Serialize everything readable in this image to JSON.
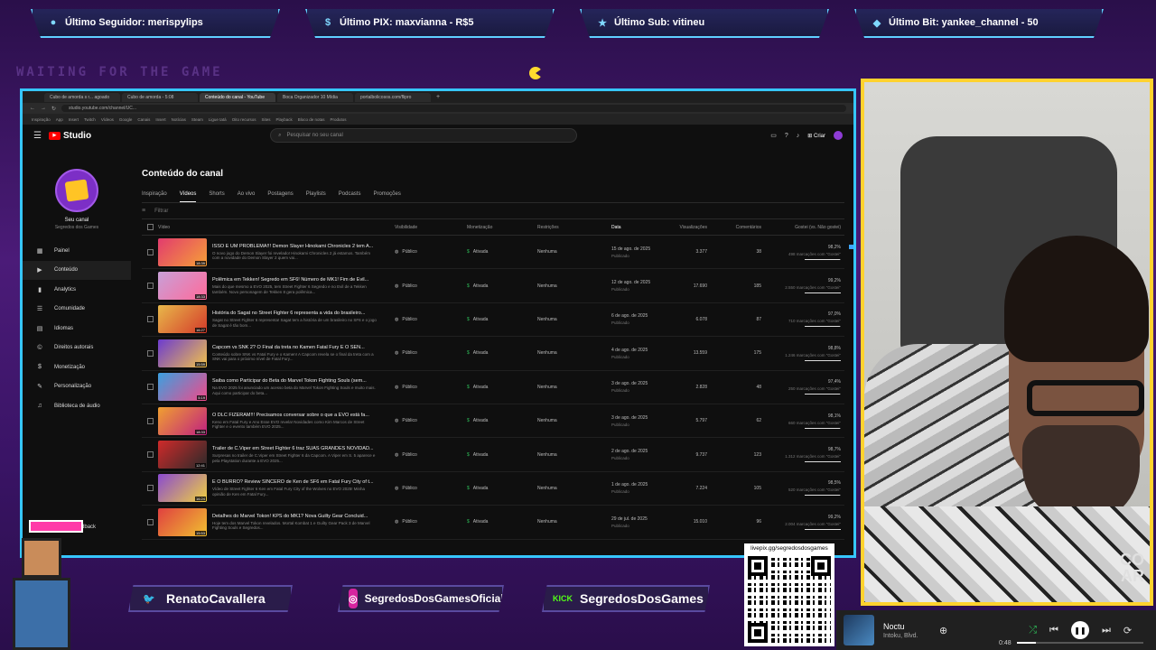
{
  "alerts": [
    {
      "label": "Último Seguidor: merispylips",
      "icon": "user-icon"
    },
    {
      "label": "Último PIX: maxvianna - R$5",
      "icon": "dollar-icon"
    },
    {
      "label": "Último Sub: vitineu",
      "icon": "star-icon"
    },
    {
      "label": "Último Bit: yankee_channel - 50",
      "icon": "diamond-icon"
    }
  ],
  "background_text": "WAITING FOR THE GAME",
  "browser": {
    "tabs": [
      "Cubo de amorda s r... agoado",
      "Cubo de amorda - 5:08",
      "Conteúdo do canal - YouTube",
      "Boca Organizador 10 Mídia",
      "portalbolicosos.com/flipro"
    ],
    "url": "studio.youtube.com/channel/UC...",
    "bookmarks": [
      "Inspiração",
      "App",
      "Insert",
      "Twitch",
      "Vídeos",
      "Google",
      "Canais",
      "Insert",
      "Notícias",
      "Steam",
      "Ligue tatá",
      "Oito recursos",
      "Sites",
      "Playback",
      "Bloco de notas",
      "Produtos"
    ]
  },
  "studio": {
    "logo_text": "Studio",
    "search_placeholder": "Pesquisar no seu canal",
    "create_label": "Criar",
    "channel_name": "Seu canal",
    "channel_handle": "Segredos dos Games",
    "nav": [
      {
        "label": "Painel",
        "icon": "dashboard-icon",
        "glyph": "▦"
      },
      {
        "label": "Conteúdo",
        "icon": "content-icon",
        "glyph": "▶",
        "active": true
      },
      {
        "label": "Analytics",
        "icon": "analytics-icon",
        "glyph": "▮"
      },
      {
        "label": "Comunidade",
        "icon": "community-icon",
        "glyph": "☰"
      },
      {
        "label": "Idiomas",
        "icon": "languages-icon",
        "glyph": "▤"
      },
      {
        "label": "Direitos autorais",
        "icon": "copyright-icon",
        "glyph": "©"
      },
      {
        "label": "Monetização",
        "icon": "monetization-icon",
        "glyph": "$"
      },
      {
        "label": "Personalização",
        "icon": "customization-icon",
        "glyph": "✎"
      },
      {
        "label": "Biblioteca de áudio",
        "icon": "audio-library-icon",
        "glyph": "♫"
      }
    ],
    "feedback_label": "Enviar feedback",
    "page_title": "Conteúdo do canal",
    "tabs": [
      "Inspiração",
      "Vídeos",
      "Shorts",
      "Ao vivo",
      "Postagens",
      "Playlists",
      "Podcasts",
      "Promoções"
    ],
    "active_tab": "Vídeos",
    "filter_label": "Filtrar",
    "columns": [
      "Vídeo",
      "Visibilidade",
      "Monetização",
      "Restrições",
      "Data",
      "Visualizações",
      "Comentários",
      "Gostei (vs. Não gostei)"
    ],
    "videos": [
      {
        "title": "ISSO É UM PROBLEMA!!! Demon Slayer Hinokami Chronicles 2 tem A...",
        "desc": "O novo jogo do Demon Slayer foi revelado! Hinokami Chronicles 2 já estamos. Também com a novidade do Demon Slayer 2 quem vai...",
        "duration": "18:39",
        "visibility": "Público",
        "monetization": "Ativada",
        "restrictions": "Nenhuma",
        "date": "15 de ago. de 2025",
        "status": "Publicado",
        "views": "3.377",
        "comments": "38",
        "likes_pct": "98,2%",
        "likes_sub": "498 marcações com \"Gostei\"",
        "ratio": 0.98,
        "thumb": [
          "#e23b6e",
          "#f6a037"
        ]
      },
      {
        "title": "Polêmica em Tekken! Segredo em SF6! Número de MK1! Fim de Evil...",
        "desc": "Mais do que mesmo a EVO 2025, tem Street Fighter 6 Segredo e no Evil de a Tekken também. Novo personagem de Tekken 8 gera polêmica...",
        "duration": "18:33",
        "visibility": "Público",
        "monetization": "Ativada",
        "restrictions": "Nenhuma",
        "date": "12 de ago. de 2025",
        "status": "Publicado",
        "views": "17.690",
        "comments": "185",
        "likes_pct": "99,2%",
        "likes_sub": "2.550 marcações com \"Gostei\"",
        "ratio": 0.99,
        "thumb": [
          "#c8a0d8",
          "#ff6a9a"
        ]
      },
      {
        "title": "História do Sagat no Street Fighter 6 representa a vida do brasileiro...",
        "desc": "Sagat no Street Fighter 6 representa! Sagat tem a história de um brasileiro no SF6 e o jogo de Sagat é tão bom...",
        "duration": "16:27",
        "visibility": "Público",
        "monetization": "Ativada",
        "restrictions": "Nenhuma",
        "date": "6 de ago. de 2025",
        "status": "Publicado",
        "views": "6.078",
        "comments": "87",
        "likes_pct": "97,0%",
        "likes_sub": "710 marcações com \"Gostei\"",
        "ratio": 0.97,
        "thumb": [
          "#e8b84a",
          "#d43a2a"
        ]
      },
      {
        "title": "Capcom vs SNK 2? O Final da treta no Kamen Fatal Fury É O SEN...",
        "desc": "Conteúdo sobre SNK vs Fatal Fury e o Kamen! A Capcom revela se o final da treta com a SNK vai para o próximo nível de Fatal Fury...",
        "duration": "15:59",
        "visibility": "Público",
        "monetization": "Ativada",
        "restrictions": "Nenhuma",
        "date": "4 de ago. de 2025",
        "status": "Publicado",
        "views": "13.559",
        "comments": "175",
        "likes_pct": "98,8%",
        "likes_sub": "1.246 marcações com \"Gostei\"",
        "ratio": 0.99,
        "thumb": [
          "#6c3bd0",
          "#f2c24a"
        ]
      },
      {
        "title": "Saiba como Participar do Beta do Marvel Tokon Fighting Souls (sem...",
        "desc": "Na EVO 2025 foi anunciado um acesso beta do Marvel Tokon Fighting Souls e muito mais. Aqui como participar do beta...",
        "duration": "5:19",
        "visibility": "Público",
        "monetization": "Ativada",
        "restrictions": "Nenhuma",
        "date": "3 de ago. de 2025",
        "status": "Publicado",
        "views": "2.828",
        "comments": "48",
        "likes_pct": "97,4%",
        "likes_sub": "250 marcações com \"Gostei\"",
        "ratio": 0.97,
        "thumb": [
          "#3aa0e0",
          "#f04a8a"
        ]
      },
      {
        "title": "O DLC FIZERAM!!! Precisamos conversar sobre o que a EVO está fa...",
        "desc": "Keno em Fatal Fury e Ano Esse EVO revela! Novidades como Kim Marcos de Street Fighter e o evento também EVO 2025...",
        "duration": "18:33",
        "visibility": "Público",
        "monetization": "Ativada",
        "restrictions": "Nenhuma",
        "date": "3 de ago. de 2025",
        "status": "Publicado",
        "views": "5.797",
        "comments": "62",
        "likes_pct": "98,1%",
        "likes_sub": "660 marcações com \"Gostei\"",
        "ratio": 0.98,
        "thumb": [
          "#f0a030",
          "#c02080"
        ]
      },
      {
        "title": "Trailer de C.Viper em Street Fighter 6 traz SUAS GRANDES NOVIDAD...",
        "desc": "Surpresas no trailer de C.Viper em Street Fighter 6 da Capcom. A Viper em S. 5 aparece e pela Playstation durante a EVO 2025...",
        "duration": "12:41",
        "visibility": "Público",
        "monetization": "Ativada",
        "restrictions": "Nenhuma",
        "date": "2 de ago. de 2025",
        "status": "Publicado",
        "views": "9.737",
        "comments": "123",
        "likes_pct": "98,7%",
        "likes_sub": "1.312 marcações com \"Gostei\"",
        "ratio": 0.99,
        "thumb": [
          "#d02a2a",
          "#2a2a2a"
        ]
      },
      {
        "title": "É O BURRO? Review SINCERO de Ken de SF6 em Fatal Fury City of t...",
        "desc": "Vídeo de Street Fighter 6 Ken em Fatal Fury City of the Wolves no EVO 2025! Minha opinião de Ken em Fatal Fury...",
        "duration": "16:24",
        "visibility": "Público",
        "monetization": "Ativada",
        "restrictions": "Nenhuma",
        "date": "1 de ago. de 2025",
        "status": "Publicado",
        "views": "7.224",
        "comments": "105",
        "likes_pct": "98,5%",
        "likes_sub": "520 marcações com \"Gostei\"",
        "ratio": 0.98,
        "thumb": [
          "#8a4ad0",
          "#f0d040"
        ]
      },
      {
        "title": "Detalhes do Marvel Tokon! KPS do MK1? Nova Guilty Gear Concluid...",
        "desc": "Hoje tem dos Marvel Tokon revelados. Mortal Kombat 1 e Guilty Gear Pack 3 de Marvel Fighting Souls e Segredos...",
        "duration": "15:53",
        "visibility": "Público",
        "monetization": "Ativada",
        "restrictions": "Nenhuma",
        "date": "29 de jul. de 2025",
        "status": "Publicado",
        "views": "15.010",
        "comments": "96",
        "likes_pct": "99,2%",
        "likes_sub": "2.004 marcações com \"Gostei\"",
        "ratio": 0.99,
        "thumb": [
          "#e04040",
          "#f0c030"
        ]
      }
    ]
  },
  "social": [
    {
      "label": "RenatoCavallera",
      "icon": "twitter-icon",
      "color": "#1da1f2"
    },
    {
      "label": "SegredosDosGamesOficial",
      "icon": "instagram-icon",
      "color": "#d6249f"
    },
    {
      "label": "SegredosDosGames",
      "icon": "kick-icon",
      "color": "#53fc18"
    }
  ],
  "qr": {
    "url": "livepix.gg/segredosdosgames"
  },
  "player": {
    "track": "Noctu",
    "artist": "Intoku, Blvd.",
    "time": "0:48",
    "progress": 0.15
  },
  "webcam_text": "CO\nAR",
  "colors": {
    "accent": "#36c6ff",
    "frame": "#ffd22e",
    "background": "#3a1560"
  }
}
